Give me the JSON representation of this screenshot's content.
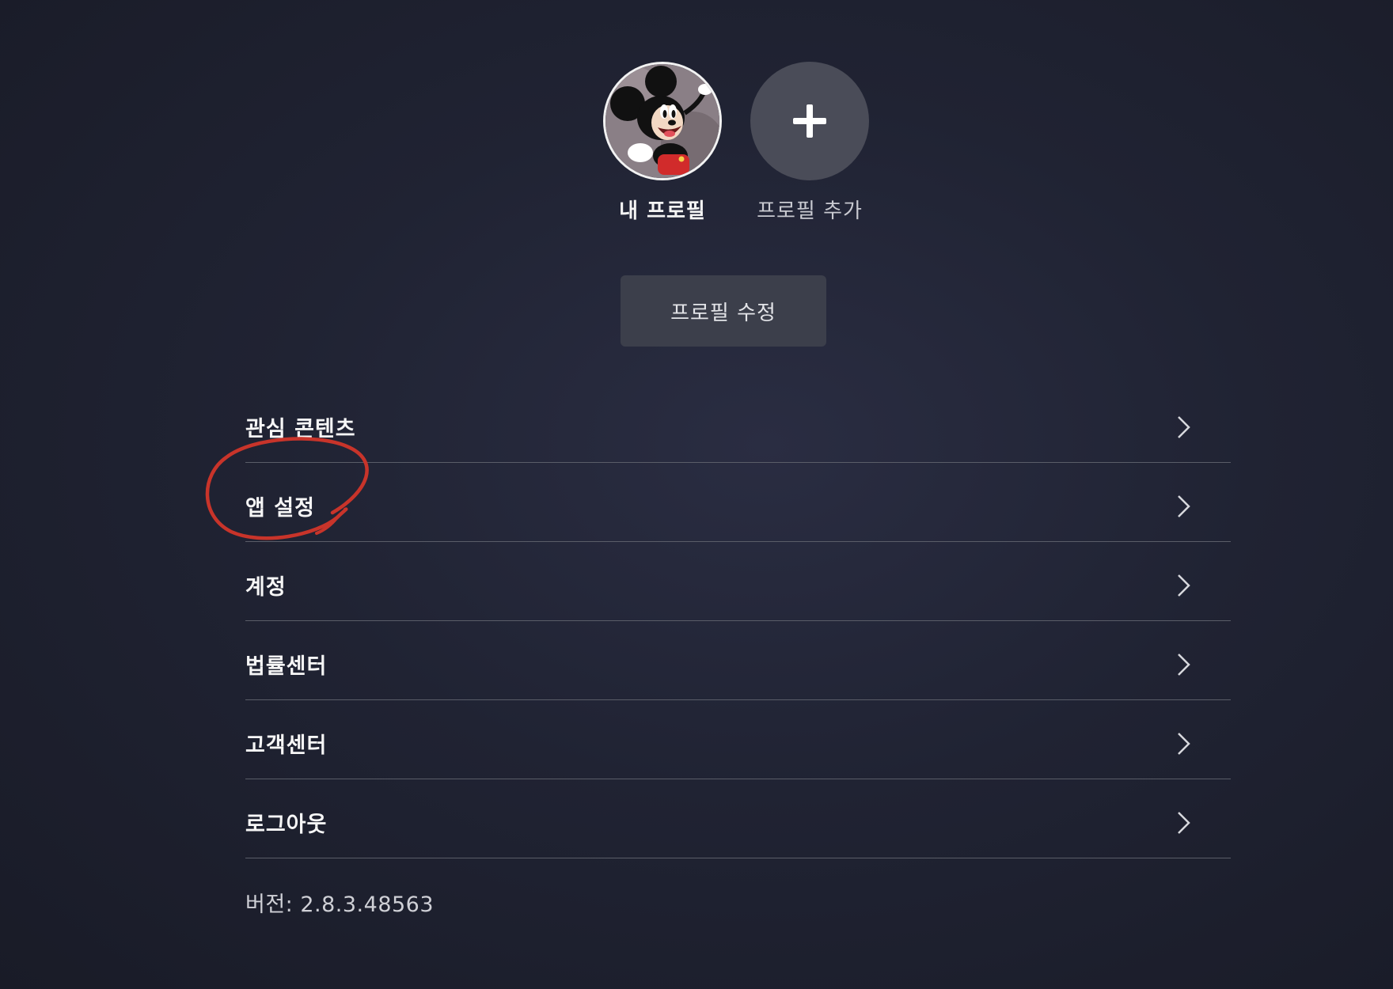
{
  "profiles": [
    {
      "name": "내 프로필",
      "avatar": "mickey-mouse-avatar"
    },
    {
      "name": "프로필 추가",
      "icon": "plus-icon"
    }
  ],
  "edit_profile_label": "프로필 수정",
  "menu": [
    {
      "label": "관심 콘텐츠",
      "icon": "chevron-right-icon"
    },
    {
      "label": "앱 설정",
      "icon": "chevron-right-icon"
    },
    {
      "label": "계정",
      "icon": "chevron-right-icon"
    },
    {
      "label": "법률센터",
      "icon": "chevron-right-icon"
    },
    {
      "label": "고객센터",
      "icon": "chevron-right-icon"
    },
    {
      "label": "로그아웃",
      "icon": "chevron-right-icon"
    }
  ],
  "version_text": "버전: 2.8.3.48563",
  "colors": {
    "background": "#202333",
    "annotation": "#c8342a",
    "button": "#3c3f4b",
    "add_circle": "#4a4c58"
  }
}
